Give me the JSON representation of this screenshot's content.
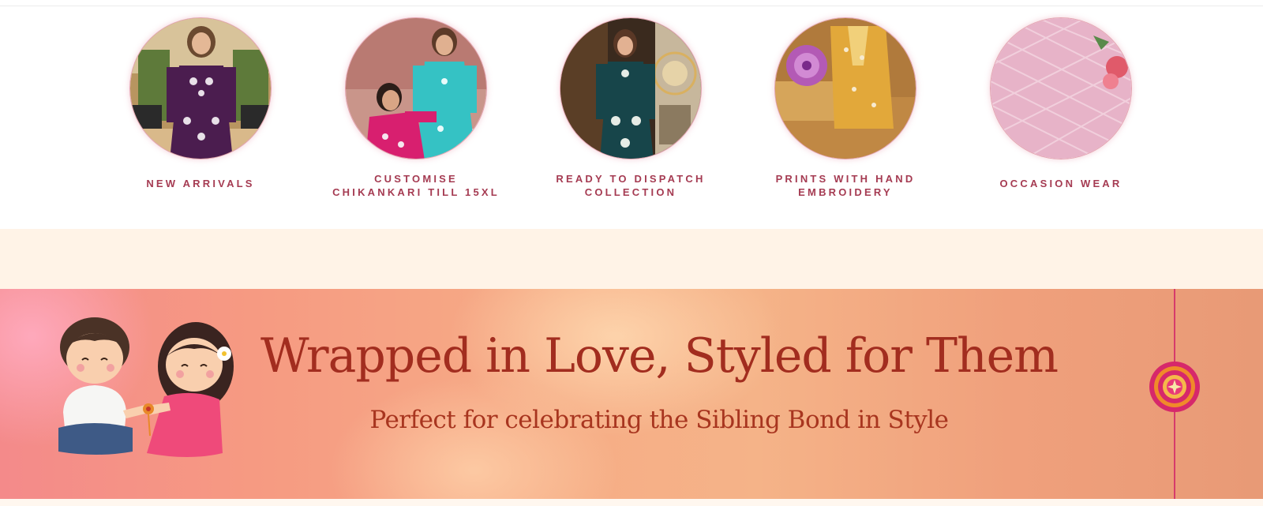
{
  "categories": [
    {
      "label": "NEW ARRIVALS",
      "image_icon": "new-arrivals-photo"
    },
    {
      "label": "CUSTOMISE CHIKANKARI TILL 15XL",
      "image_icon": "customise-chikankari-photo"
    },
    {
      "label": "READY TO DISPATCH COLLECTION",
      "image_icon": "ready-to-dispatch-photo"
    },
    {
      "label": "PRINTS WITH HAND EMBROIDERY",
      "image_icon": "prints-hand-embroidery-photo"
    },
    {
      "label": "OCCASION WEAR",
      "image_icon": "occasion-wear-photo"
    }
  ],
  "banner": {
    "title": "Wrapped in Love, Styled for Them",
    "subtitle": "Perfect for celebrating the Sibling Bond in Style"
  },
  "colors": {
    "label": "#a53b52",
    "banner_title": "#a22d1f",
    "cream_background": "#fff3e7"
  }
}
